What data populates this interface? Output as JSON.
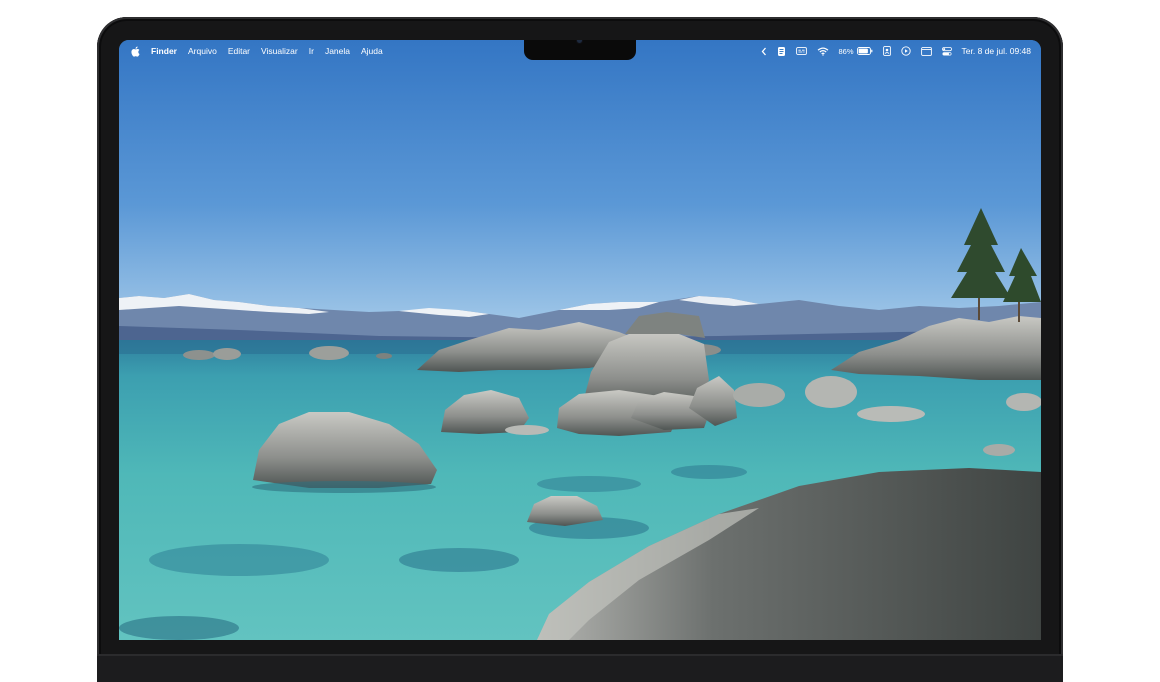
{
  "menubar": {
    "apple_icon": "apple-logo-icon",
    "app_name": "Finder",
    "menus": [
      "Arquivo",
      "Editar",
      "Visualizar",
      "Ir",
      "Janela",
      "Ajuda"
    ],
    "status": {
      "icons": [
        "chevron-left-icon",
        "script-icon",
        "captions-icon",
        "wifi-icon",
        "battery-icon",
        "contact-card-icon",
        "play-circle-icon",
        "window-icon",
        "control-center-icon"
      ],
      "battery_percent": "86%",
      "battery_level": 0.86,
      "datetime": "Ter. 8 de jul.  09:48"
    }
  },
  "colors": {
    "sky_top": "#3a7fcf",
    "sky_horizon": "#9cc5e8",
    "water": "#4fb7b6",
    "bezel": "#161617"
  }
}
